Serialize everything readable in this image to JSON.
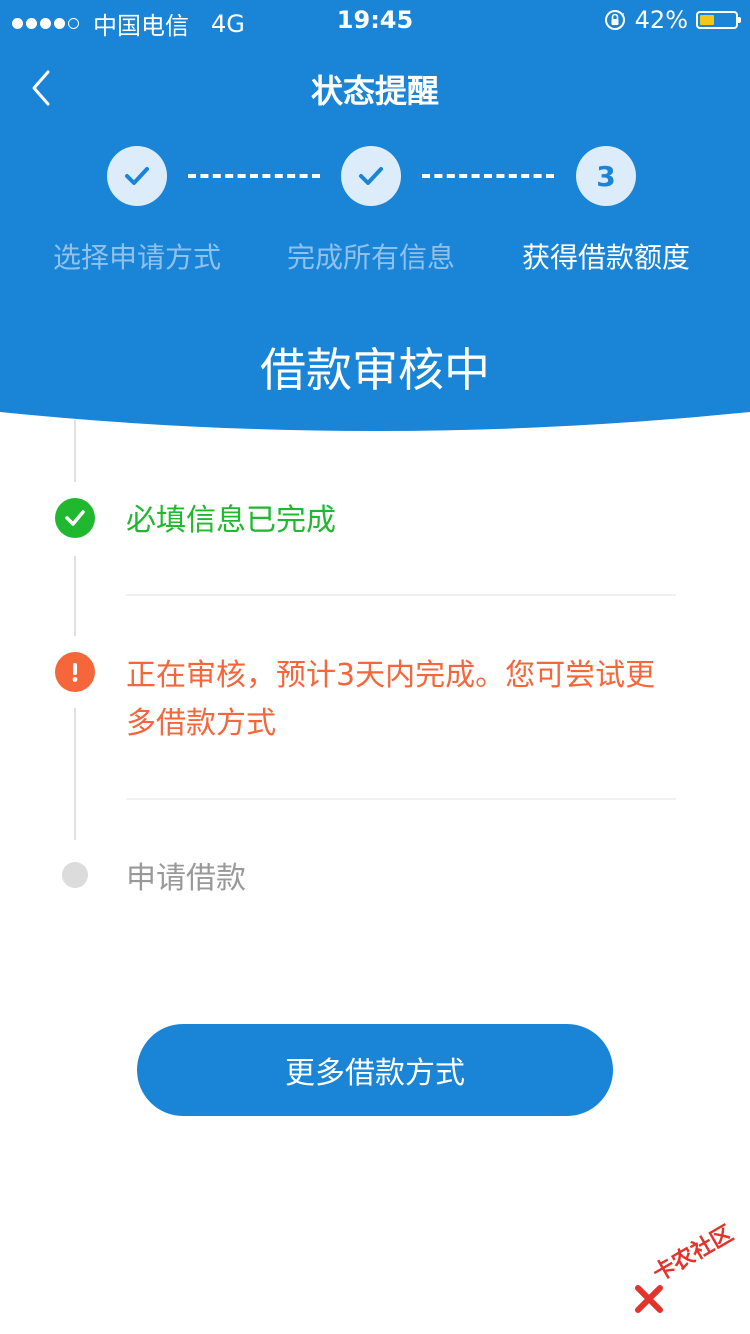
{
  "status_bar": {
    "signal_filled": 4,
    "signal_total": 5,
    "carrier": "中国电信",
    "network": "4G",
    "time": "19:45",
    "battery": "42%",
    "battery_level": 0.42,
    "orientation_lock_icon": "rotation-lock-icon"
  },
  "nav": {
    "back_icon": "chevron-left-icon",
    "title": "状态提醒"
  },
  "steps": [
    {
      "number": "",
      "status": "done",
      "icon": "check-icon",
      "label": "选择申请方式"
    },
    {
      "number": "",
      "status": "done",
      "icon": "check-icon",
      "label": "完成所有信息"
    },
    {
      "number": "3",
      "status": "current",
      "label": "获得借款额度"
    }
  ],
  "banner": {
    "title": "借款审核中"
  },
  "timeline": [
    {
      "status": "success",
      "icon": "check-circle-icon",
      "text": "必填信息已完成",
      "color": "#1fb82f"
    },
    {
      "status": "warning",
      "icon": "exclamation-circle-icon",
      "text": "正在审核，预计3天内完成。您可尝试更多借款方式",
      "color": "#f5663a"
    },
    {
      "status": "pending",
      "icon": "gray-dot-icon",
      "text": "申请借款",
      "color": "#999999"
    }
  ],
  "cta": {
    "label": "更多借款方式"
  },
  "watermark": {
    "text": "卡农社区"
  },
  "colors": {
    "primary": "#1a84d6",
    "success": "#1fb82f",
    "warning": "#f5663a",
    "muted": "#999999"
  }
}
